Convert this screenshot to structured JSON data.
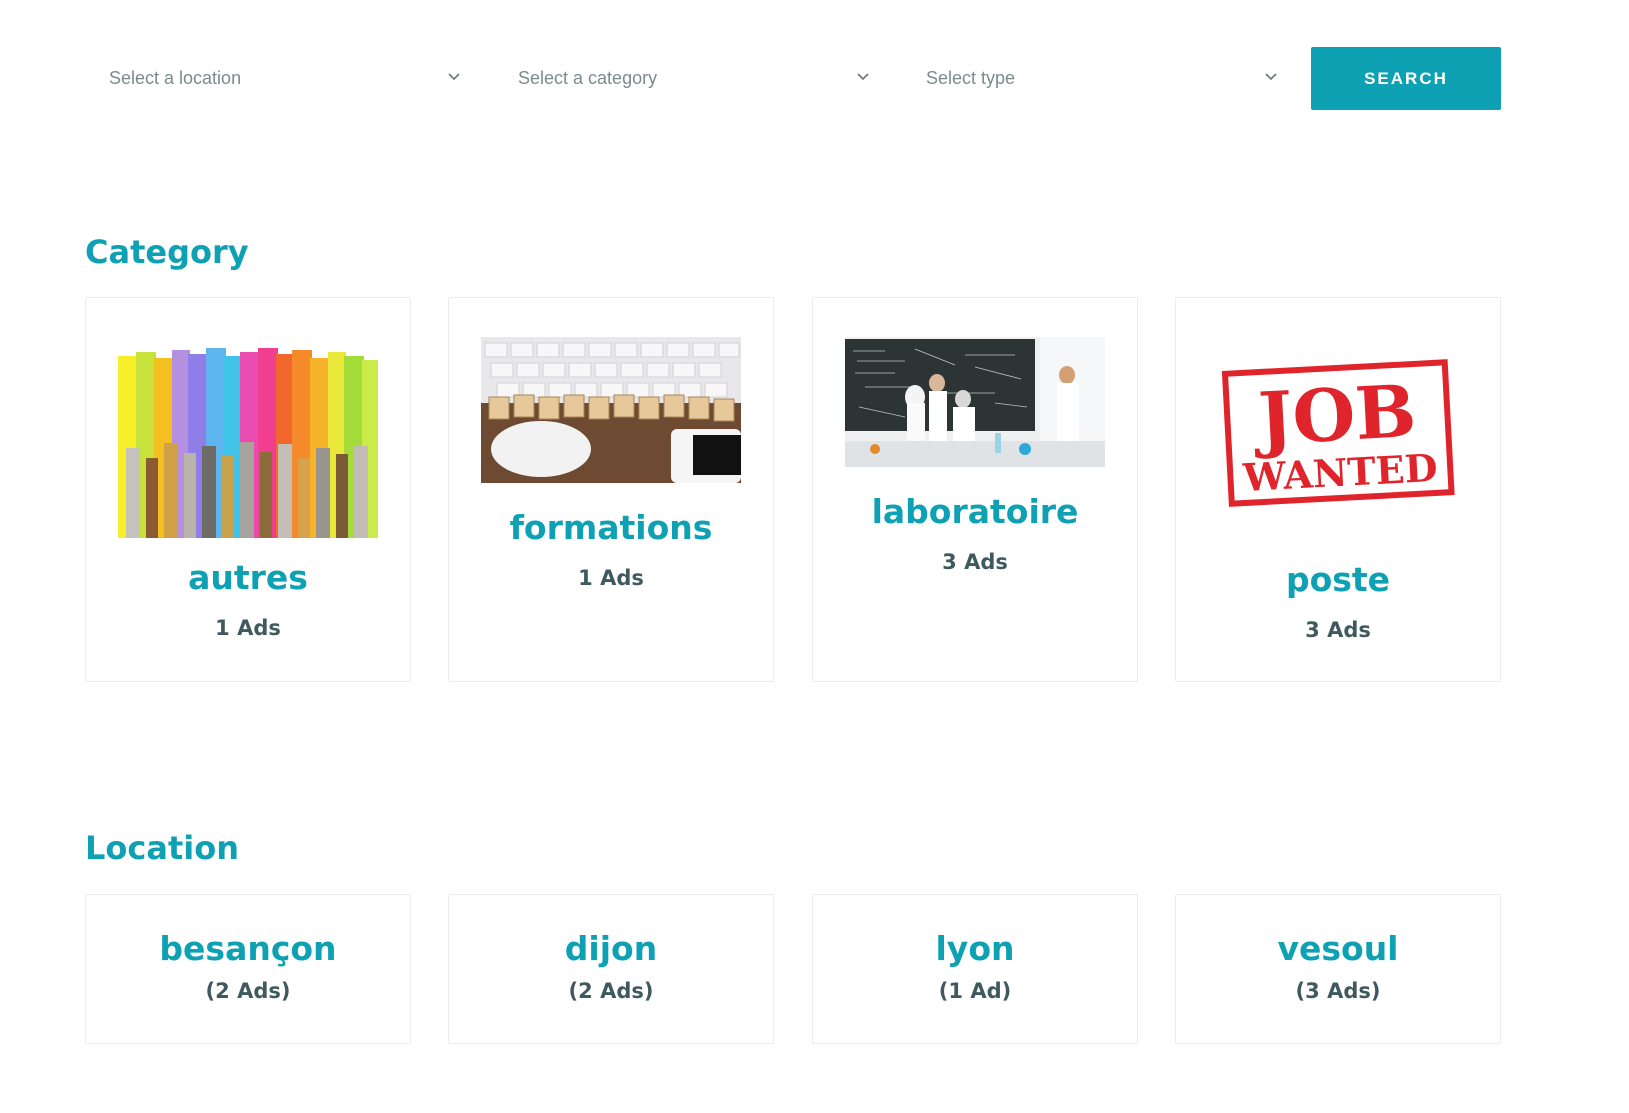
{
  "search": {
    "location_placeholder": "Select a location",
    "category_placeholder": "Select a category",
    "type_placeholder": "Select type",
    "button_label": "SEARCH"
  },
  "category_section": {
    "title": "Category",
    "items": [
      {
        "name": "autres",
        "count": "1 Ads",
        "image": "paintbrushes-image"
      },
      {
        "name": "formations",
        "count": "1 Ads",
        "image": "formation-keyboard-image"
      },
      {
        "name": "laboratoire",
        "count": "3 Ads",
        "image": "laboratory-scientists-image"
      },
      {
        "name": "poste",
        "count": "3 Ads",
        "image": "job-wanted-stamp-image",
        "stamp_line1": "JOB",
        "stamp_line2": "WANTED"
      }
    ]
  },
  "location_section": {
    "title": "Location",
    "items": [
      {
        "name": "besançon",
        "count": "(2 Ads)"
      },
      {
        "name": "dijon",
        "count": "(2 Ads)"
      },
      {
        "name": "lyon",
        "count": "(1 Ad)"
      },
      {
        "name": "vesoul",
        "count": "(3 Ads)"
      }
    ]
  },
  "colors": {
    "accent": "#0ea1b3",
    "text_dark": "#3f5a5e",
    "placeholder": "#7d8a8c",
    "stamp_red": "#e0242b"
  }
}
